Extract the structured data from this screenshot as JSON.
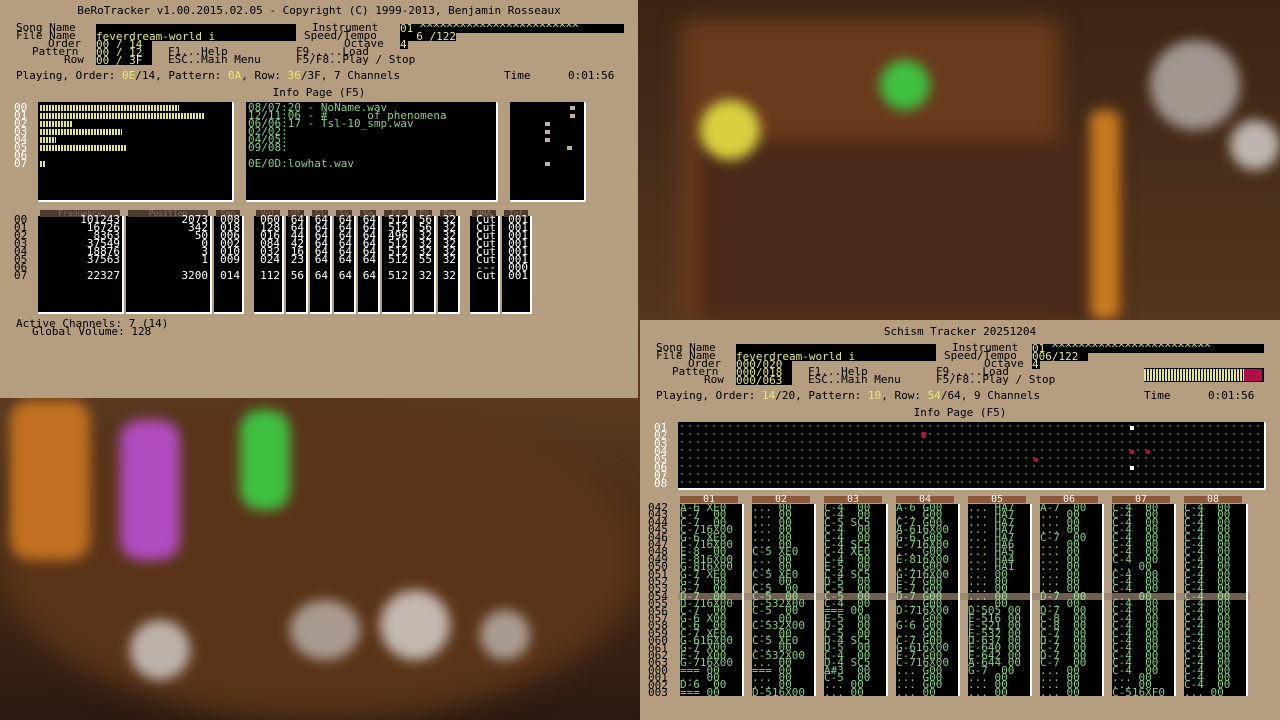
{
  "bero": {
    "title": "BeRoTracker v1.00.2015.02.05 - Copyright (C) 1999-2013, Benjamin Rosseaux",
    "labels": {
      "song_name": "Song Name",
      "file_name": "File Name",
      "order": "Order",
      "pattern": "Pattern",
      "row": "Row",
      "instrument": "Instrument",
      "speed_tempo": "Speed/Tempo",
      "octave": "Octave"
    },
    "file_name": "feverdream-world_i",
    "order": "00 / 14",
    "pattern": "00 / 12",
    "row": "00 / 3F",
    "instrument": "01 ^^^^^^^^^^^^^^^^^^^^^^^^",
    "speed_tempo": "6 /122",
    "octave": "4",
    "keys": {
      "help": "F1...Help",
      "main": "ESC..Main Menu",
      "load": "F9.....Load",
      "play": "F5/F8..Play / Stop"
    },
    "status": {
      "playing": "Playing, Order:",
      "order": "0E",
      "order_total": "/14",
      "pattern_label": ", Pattern:",
      "pattern": "0A",
      "row_label": ", Row:",
      "row": "36",
      "row_total": "/3F",
      "channels": ", 7 Channels",
      "time_label": "Time",
      "time": "0:01:56"
    },
    "info_page": "Info Page (F5)",
    "channel_numbers": [
      "00",
      "01",
      "02",
      "03",
      "04",
      "05",
      "06",
      "07"
    ],
    "samples": [
      "08/07:20 - NoName.wav",
      "12/11:06 - #      of phenomena",
      "06/06:17 - Tsl-10_smp.wav",
      "02/02:",
      "04/05:",
      "09/08:",
      "",
      "0E/0D:lowhat.wav"
    ],
    "columns": [
      "Frequency",
      "Position",
      "Smp",
      "Vol",
      "Ut",
      "Gl",
      "Sv",
      "Ve",
      "Fd",
      "Pn",
      "Pe",
      "NNA",
      "Tot"
    ],
    "channels": [
      {
        "freq": "101243",
        "pos": "2073",
        "smp": "008",
        "vol": "060",
        "ut": "64",
        "gl": "64",
        "sv": "64",
        "ve": "64",
        "fd": "512",
        "pn": "56",
        "pe": "32",
        "nna": "Cut",
        "tot": "001"
      },
      {
        "freq": "16726",
        "pos": "342",
        "smp": "018",
        "vol": "128",
        "ut": "64",
        "gl": "64",
        "sv": "64",
        "ve": "64",
        "fd": "512",
        "pn": "56",
        "pe": "32",
        "nna": "Cut",
        "tot": "001"
      },
      {
        "freq": "8363",
        "pos": "50",
        "smp": "006",
        "vol": "016",
        "ut": "44",
        "gl": "64",
        "sv": "64",
        "ve": "64",
        "fd": "496",
        "pn": "32",
        "pe": "32",
        "nna": "Cut",
        "tot": "001"
      },
      {
        "freq": "37549",
        "pos": "0",
        "smp": "002",
        "vol": "084",
        "ut": "42",
        "gl": "64",
        "sv": "64",
        "ve": "64",
        "fd": "512",
        "pn": "32",
        "pe": "32",
        "nna": "Cut",
        "tot": "001"
      },
      {
        "freq": "18876",
        "pos": "3",
        "smp": "010",
        "vol": "032",
        "ut": "16",
        "gl": "64",
        "sv": "64",
        "ve": "64",
        "fd": "512",
        "pn": "32",
        "pe": "32",
        "nna": "Cut",
        "tot": "001"
      },
      {
        "freq": "37563",
        "pos": "1",
        "smp": "009",
        "vol": "024",
        "ut": "23",
        "gl": "64",
        "sv": "64",
        "ve": "64",
        "fd": "512",
        "pn": "55",
        "pe": "32",
        "nna": "Cut",
        "tot": "001"
      },
      {
        "freq": "",
        "pos": "",
        "smp": "",
        "vol": "",
        "ut": "",
        "gl": "",
        "sv": "",
        "ve": "",
        "fd": "",
        "pn": "",
        "pe": "",
        "nna": "---",
        "tot": "000"
      },
      {
        "freq": "22327",
        "pos": "3200",
        "smp": "014",
        "vol": "112",
        "ut": "56",
        "gl": "64",
        "sv": "64",
        "ve": "64",
        "fd": "512",
        "pn": "32",
        "pe": "32",
        "nna": "Cut",
        "tot": "001"
      }
    ],
    "vu_levels": [
      0.85,
      1.0,
      0.2,
      0.5,
      0.1,
      0.53,
      0.0,
      0.03
    ],
    "active_channels": "Active Channels: 7 (14)",
    "global_volume": "Global Volume: 128"
  },
  "schism": {
    "title": "Schism Tracker 20251204",
    "labels": {
      "song_name": "Song Name",
      "file_name": "File Name",
      "order": "Order",
      "pattern": "Pattern",
      "row": "Row",
      "instrument": "Instrument",
      "speed_tempo": "Speed/Tempo",
      "octave": "Octave"
    },
    "file_name": "feverdream-world_i",
    "order": "000/020",
    "pattern": "000/018",
    "row": "000/063",
    "instrument": "01 ^^^^^^^^^^^^^^^^^^^^^^^^",
    "speed_tempo": "006/122",
    "octave": "4",
    "keys": {
      "help": "F1...Help",
      "main": "ESC..Main Menu",
      "load": "F9.....Load",
      "play": "F5/F8..Play / Stop"
    },
    "status": {
      "playing": "Playing, Order:",
      "order": "14",
      "order_total": "/20",
      "pattern_label": ", Pattern:",
      "pattern": "10",
      "row_label": ", Row:",
      "row": "54",
      "row_total": "/64",
      "channels": ", 9 Channels",
      "time_label": "Time",
      "time": "0:01:56"
    },
    "info_page": "Info Page (F5)",
    "scope_rows": [
      "01",
      "02",
      "03",
      "04",
      "05",
      "06",
      "07",
      "08"
    ],
    "track_headers": [
      "01",
      "02",
      "03",
      "04",
      "05",
      "06",
      "07",
      "08"
    ],
    "row_numbers": [
      "042",
      "043",
      "044",
      "045",
      "046",
      "047",
      "048",
      "049",
      "050",
      "051",
      "052",
      "053",
      "054",
      "055",
      "056",
      "057",
      "058",
      "059",
      "060",
      "061",
      "062",
      "063",
      "000",
      "001",
      "002",
      "003"
    ],
    "tracks": [
      [
        "A-6 XE0",
        "C-7  00",
        "C-7  00",
        "C-716X00",
        "G-6 XE0",
        "C-716X00",
        "E-8  00",
        "E-816X00",
        "G-816X00",
        "G-7 XE0",
        "G-7  00",
        "G-7  00",
        "D-7  00",
        "D-716X00",
        "C-7  00",
        "G-6 X00",
        "C-6  00",
        "C-7 XE0",
        "G-616X00",
        "G-7 X00",
        "E-7 X00",
        "G-716X00",
        "=== 00",
        "... 00",
        "D-6  00",
        "=== 00"
      ],
      [
        "... 00",
        "... 00",
        "... 00",
        "... 00",
        "... 00",
        "... 00",
        "C-5 XE0",
        "... 00",
        "... 00",
        "C-5 XE0",
        "... 00",
        "C-5  00",
        "C-5  00",
        "C-532X00",
        "C-5  00",
        "... 00",
        "C-532X00",
        "... 00",
        "C-5 XE0",
        "... 00",
        "C-532X00",
        "... 00",
        "=== 00",
        "... 00",
        "... 00",
        "D-516X00"
      ],
      [
        "C-4  00",
        "C-4  00",
        "C-5 SC5",
        "C-4  00",
        "C-4  00",
        "C-4 SC5",
        "C-4 XE0",
        "C-4  00",
        "E-5  00",
        "C-4 SC5",
        "D-5  00",
        "C-5  00",
        "C-5  00",
        "C-4  00",
        "=== 00",
        "E-5  00",
        "D-5  00",
        "C-5  00",
        "D-4 SC5",
        "D-5  00",
        "C-4  00",
        "D-4 SC5",
        "A#3  00",
        "C-5  00",
        "... 00",
        "... 00"
      ],
      [
        "A-6 G00",
        "... G00",
        "C-7 G00",
        "A-616X00",
        "G-6 G00",
        "C-716X00",
        "... G00",
        "E-816X00",
        "... G00",
        "G-716X00",
        "E-7 G00",
        "E-7 G00",
        "D-7 G00",
        "... G00",
        "D-716X00",
        "... G00",
        "G-6 G00",
        "... G00",
        "C-7 G00",
        "G-616X00",
        "E-7 G00",
        "C-716X00",
        "... G00",
        "... G00",
        "... G00",
        "... 00"
      ],
      [
        "... HA7",
        "... HA7",
        "... HA7",
        "... HA7",
        "... HA7",
        "... HA6",
        "... HA5",
        "... HA4",
        "... HA1",
        "... 00",
        "... 00",
        "... 00",
        "... 00",
        "... 00",
        "D-505 00",
        "F-516 00",
        "F-521 00",
        "E-532 00",
        "D-637 00",
        "E-640 00",
        "E-642 00",
        "A-644 00",
        "G-7  00",
        "... 00",
        "... 00",
        "... 00"
      ],
      [
        "A-7  00",
        "... 00",
        "... 00",
        "... 00",
        "C-7  00",
        "... 00",
        "... 00",
        "... 00",
        "... 00",
        "... 00",
        "... 00",
        "... 00",
        "D-7  00",
        "... 00",
        "D-7  00",
        "C-8  00",
        "C-8  00",
        "C-7  00",
        "D-7  00",
        "C-7  00",
        "D-7  00",
        "C-7  00",
        "... 00",
        "... 00",
        "... 00",
        "... 00"
      ],
      [
        "C-4  00",
        "C-4  00",
        "C-4  00",
        "C-4  00",
        "C-4  00",
        "C-4  00",
        "C-4  00",
        "C-4  00",
        "... 00",
        "C-4  00",
        "C-4  00",
        "C-4  00",
        "... 00",
        "C-4  00",
        "C-4  00",
        "C-4  00",
        "C-4  00",
        "C-4  00",
        "C-4  00",
        "C-4  00",
        "C-4  00",
        "C-4  00",
        "C-4  00",
        "... 00",
        "... 00",
        "C-516XF0"
      ],
      [
        "C-4  00",
        "C-4  00",
        "C-4  00",
        "C-4  00",
        "C-4  00",
        "C-4  00",
        "C-4  00",
        "C-4  00",
        "C-4  00",
        "C-4  00",
        "C-4  00",
        "C-4  00",
        "C-4  00",
        "C-4  00",
        "C-4  00",
        "C-4  00",
        "C-4  00",
        "C-4  00",
        "C-4  00",
        "C-4  00",
        "C-4  00",
        "C-4  00",
        "C-4  00",
        "C-4  00",
        "C-4  00",
        "... 00"
      ]
    ]
  }
}
